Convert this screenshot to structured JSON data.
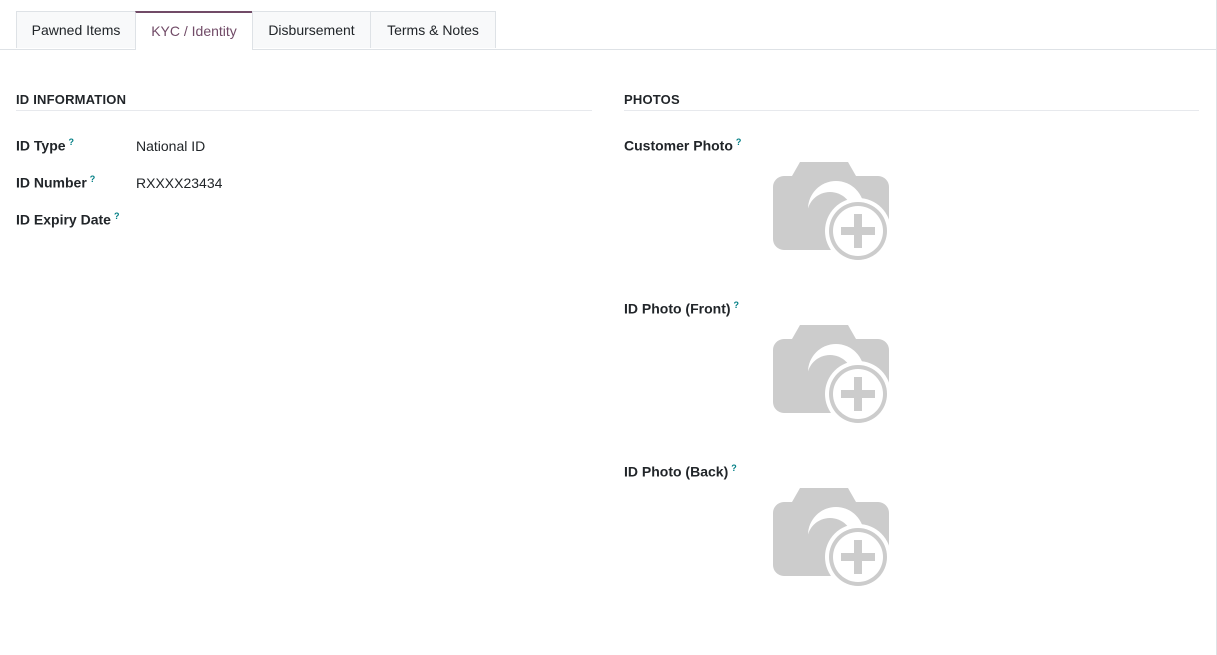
{
  "tabs": [
    {
      "label": "Pawned Items",
      "active": false
    },
    {
      "label": "KYC / Identity",
      "active": true
    },
    {
      "label": "Disbursement",
      "active": false
    },
    {
      "label": "Terms & Notes",
      "active": false
    }
  ],
  "id_information": {
    "title": "ID INFORMATION",
    "fields": [
      {
        "label": "ID Type",
        "help": "?",
        "value": "National ID"
      },
      {
        "label": "ID Number",
        "help": "?",
        "value": "RXXXX23434"
      },
      {
        "label": "ID Expiry Date",
        "help": "?",
        "value": ""
      }
    ]
  },
  "photos": {
    "title": "PHOTOS",
    "fields": [
      {
        "label": "Customer Photo",
        "help": "?",
        "icon": "camera-add-icon"
      },
      {
        "label": "ID Photo (Front)",
        "help": "?",
        "icon": "camera-add-icon"
      },
      {
        "label": "ID Photo (Back)",
        "help": "?",
        "icon": "camera-add-icon"
      }
    ]
  },
  "colors": {
    "accent": "#714b67",
    "help": "#017e84",
    "placeholder_icon": "#cccccc"
  }
}
